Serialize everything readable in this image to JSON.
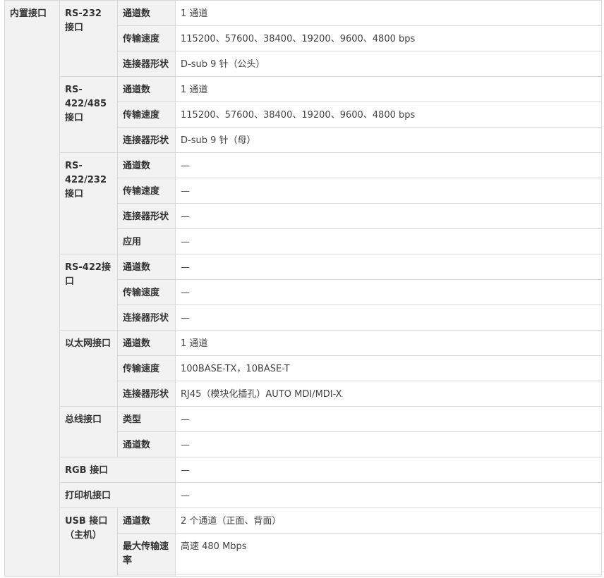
{
  "table": {
    "section": "内置接口",
    "groups": [
      {
        "name": "RS-232 接口",
        "rows": [
          {
            "label": "通道数",
            "value": "1 通道"
          },
          {
            "label": "传输速度",
            "value": "115200、57600、38400、19200、9600、4800 bps"
          },
          {
            "label": "连接器形状",
            "value": "D-sub 9 针（公头）"
          }
        ]
      },
      {
        "name": "RS-422/485接口",
        "rows": [
          {
            "label": "通道数",
            "value": "1 通道"
          },
          {
            "label": "传输速度",
            "value": "115200、57600、38400、19200、9600、4800 bps"
          },
          {
            "label": "连接器形状",
            "value": "D-sub 9 针（母）"
          }
        ]
      },
      {
        "name": "RS-422/232接口",
        "rows": [
          {
            "label": "通道数",
            "value": "—"
          },
          {
            "label": "传输速度",
            "value": "—"
          },
          {
            "label": "连接器形状",
            "value": "—"
          },
          {
            "label": "应用",
            "value": "—"
          }
        ]
      },
      {
        "name": "RS-422接口",
        "rows": [
          {
            "label": "通道数",
            "value": "—"
          },
          {
            "label": "传输速度",
            "value": "—"
          },
          {
            "label": "连接器形状",
            "value": "—"
          }
        ]
      },
      {
        "name": "以太网接口",
        "rows": [
          {
            "label": "通道数",
            "value": "1 通道"
          },
          {
            "label": "传输速度",
            "value": "100BASE-TX，10BASE-T"
          },
          {
            "label": "连接器形状",
            "value": "RJ45（模块化插孔）AUTO MDI/MDI-X"
          }
        ]
      },
      {
        "name": "总线接口",
        "rows": [
          {
            "label": "类型",
            "value": "—"
          },
          {
            "label": "通道数",
            "value": "—"
          }
        ]
      },
      {
        "name": "RGB 接口",
        "value": "—"
      },
      {
        "name": "打印机接口",
        "value": "—"
      },
      {
        "name": "USB 接口（主机）",
        "rows": [
          {
            "label": "通道数",
            "value": "2 个通道（正面、背面）"
          },
          {
            "label": "最大传输速率",
            "value": "高速 480 Mbps"
          }
        ]
      }
    ]
  }
}
